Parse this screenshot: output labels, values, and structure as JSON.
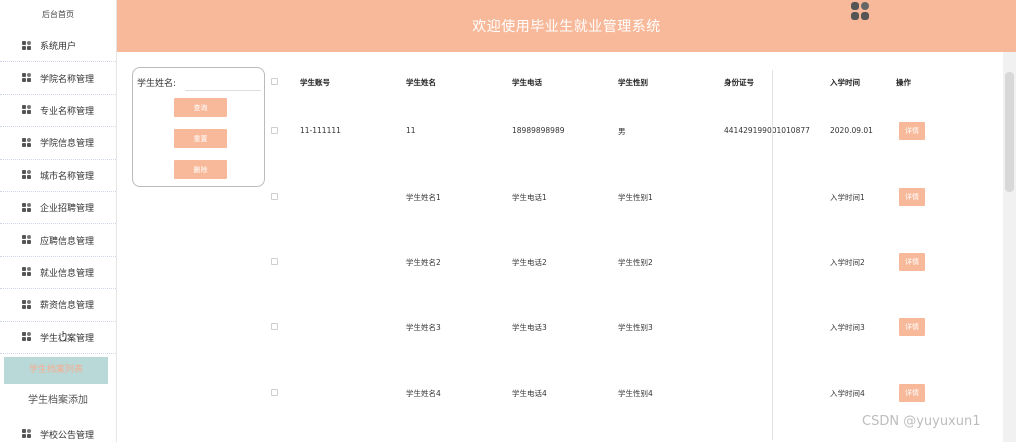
{
  "header": {
    "title": "欢迎使用毕业生就业管理系统",
    "logo_icon": "app-logo-icon"
  },
  "sidebar": {
    "home": "后台首页",
    "items": [
      "系统用户",
      "学院名称管理",
      "专业名称管理",
      "学院信息管理",
      "城市名称管理",
      "企业招聘管理",
      "应聘信息管理",
      "就业信息管理",
      "薪资信息管理",
      "学生档案管理"
    ],
    "sub_active": "学生档案列表",
    "sub": "学生档案添加",
    "last": "学校公告管理"
  },
  "search": {
    "label": "学生姓名:",
    "placeholder": "",
    "query_btn": "查询",
    "reset_btn": "重置",
    "delete_btn": "删除"
  },
  "table": {
    "headers": [
      "学生账号",
      "学生姓名",
      "学生电话",
      "学生性别",
      "身份证号",
      "入学时间",
      "操作"
    ],
    "rows": [
      [
        "11-111111",
        "11",
        "18989898989",
        "男",
        "441429199001010877",
        "2020.09.01"
      ],
      [
        "",
        "学生姓名1",
        "学生电话1",
        "学生性别1",
        "",
        "入学时间1"
      ],
      [
        "",
        "学生姓名2",
        "学生电话2",
        "学生性别2",
        "",
        "入学时间2"
      ],
      [
        "",
        "学生姓名3",
        "学生电话3",
        "学生性别3",
        "",
        "入学时间3"
      ],
      [
        "",
        "学生姓名4",
        "学生电话4",
        "学生性别4",
        "",
        "入学时间4"
      ]
    ],
    "detail_btn": "详情"
  },
  "watermark": "CSDN @yuyuxun1",
  "colors": {
    "accent": "#f8b99a",
    "active_bg": "#b9d9d8"
  }
}
